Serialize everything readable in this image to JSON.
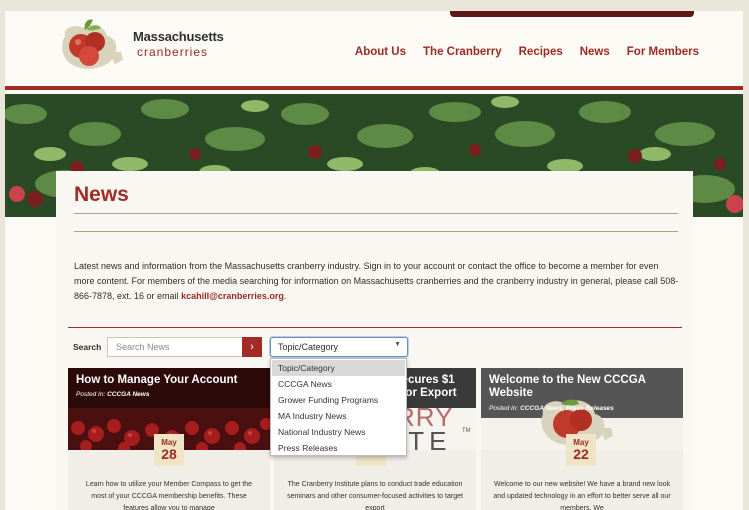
{
  "header": {
    "logo_line1": "Massachusetts",
    "logo_line2": "cranberries",
    "nav": [
      "About Us",
      "The Cranberry",
      "Recipes",
      "News",
      "For Members"
    ]
  },
  "page": {
    "title": "News",
    "intro": "Latest news and information from the Massachusetts cranberry industry.  Sign in to your account or contact the office to become a member for even more content. For members of the media searching for information on Massachusetts cranberries and the cranberry industry in general, please call 508-866-7878, ext. 16 or email",
    "email": "kcahill@cranberries.org",
    "intro_end": "."
  },
  "filters": {
    "search_label": "Search",
    "search_placeholder": "Search News",
    "search_button_glyph": "›",
    "select_value": "Topic/Category",
    "options": [
      "Topic/Category",
      "CCCGA News",
      "Grower Funding Programs",
      "MA Industry News",
      "National Industry News",
      "Press Releases"
    ]
  },
  "cards": [
    {
      "title": "How to Manage Your Account",
      "posted_prefix": "Posted In:",
      "posted_tags": "CCCGA News",
      "month": "May",
      "day": "28",
      "excerpt": "Learn how to utilize your Member Compass to get the most of your CCCGA membership benefits. These features allow you to manage"
    },
    {
      "title": "...ecures $1 ...for Export",
      "posted_prefix": "",
      "posted_tags": "",
      "month": "",
      "day": "24",
      "excerpt": "The Cranberry Institute plans to conduct trade education seminars and other consumer-focused activities to target export",
      "image_text_1": "RRY",
      "image_text_2": "ITE",
      "tm": "TM"
    },
    {
      "title": "Welcome to the New CCCGA Website",
      "posted_prefix": "Posted In:",
      "posted_tags": "CCCGA News, Press Releases",
      "month": "May",
      "day": "22",
      "excerpt": "Welcome to our new website! We have a brand new look and updated technology in an effort to better serve all our members. We"
    }
  ],
  "colors": {
    "brand_red": "#a32b25",
    "dark_red": "#5e1916",
    "background": "#e9e6d9",
    "card_bg": "#f8f7f1"
  }
}
